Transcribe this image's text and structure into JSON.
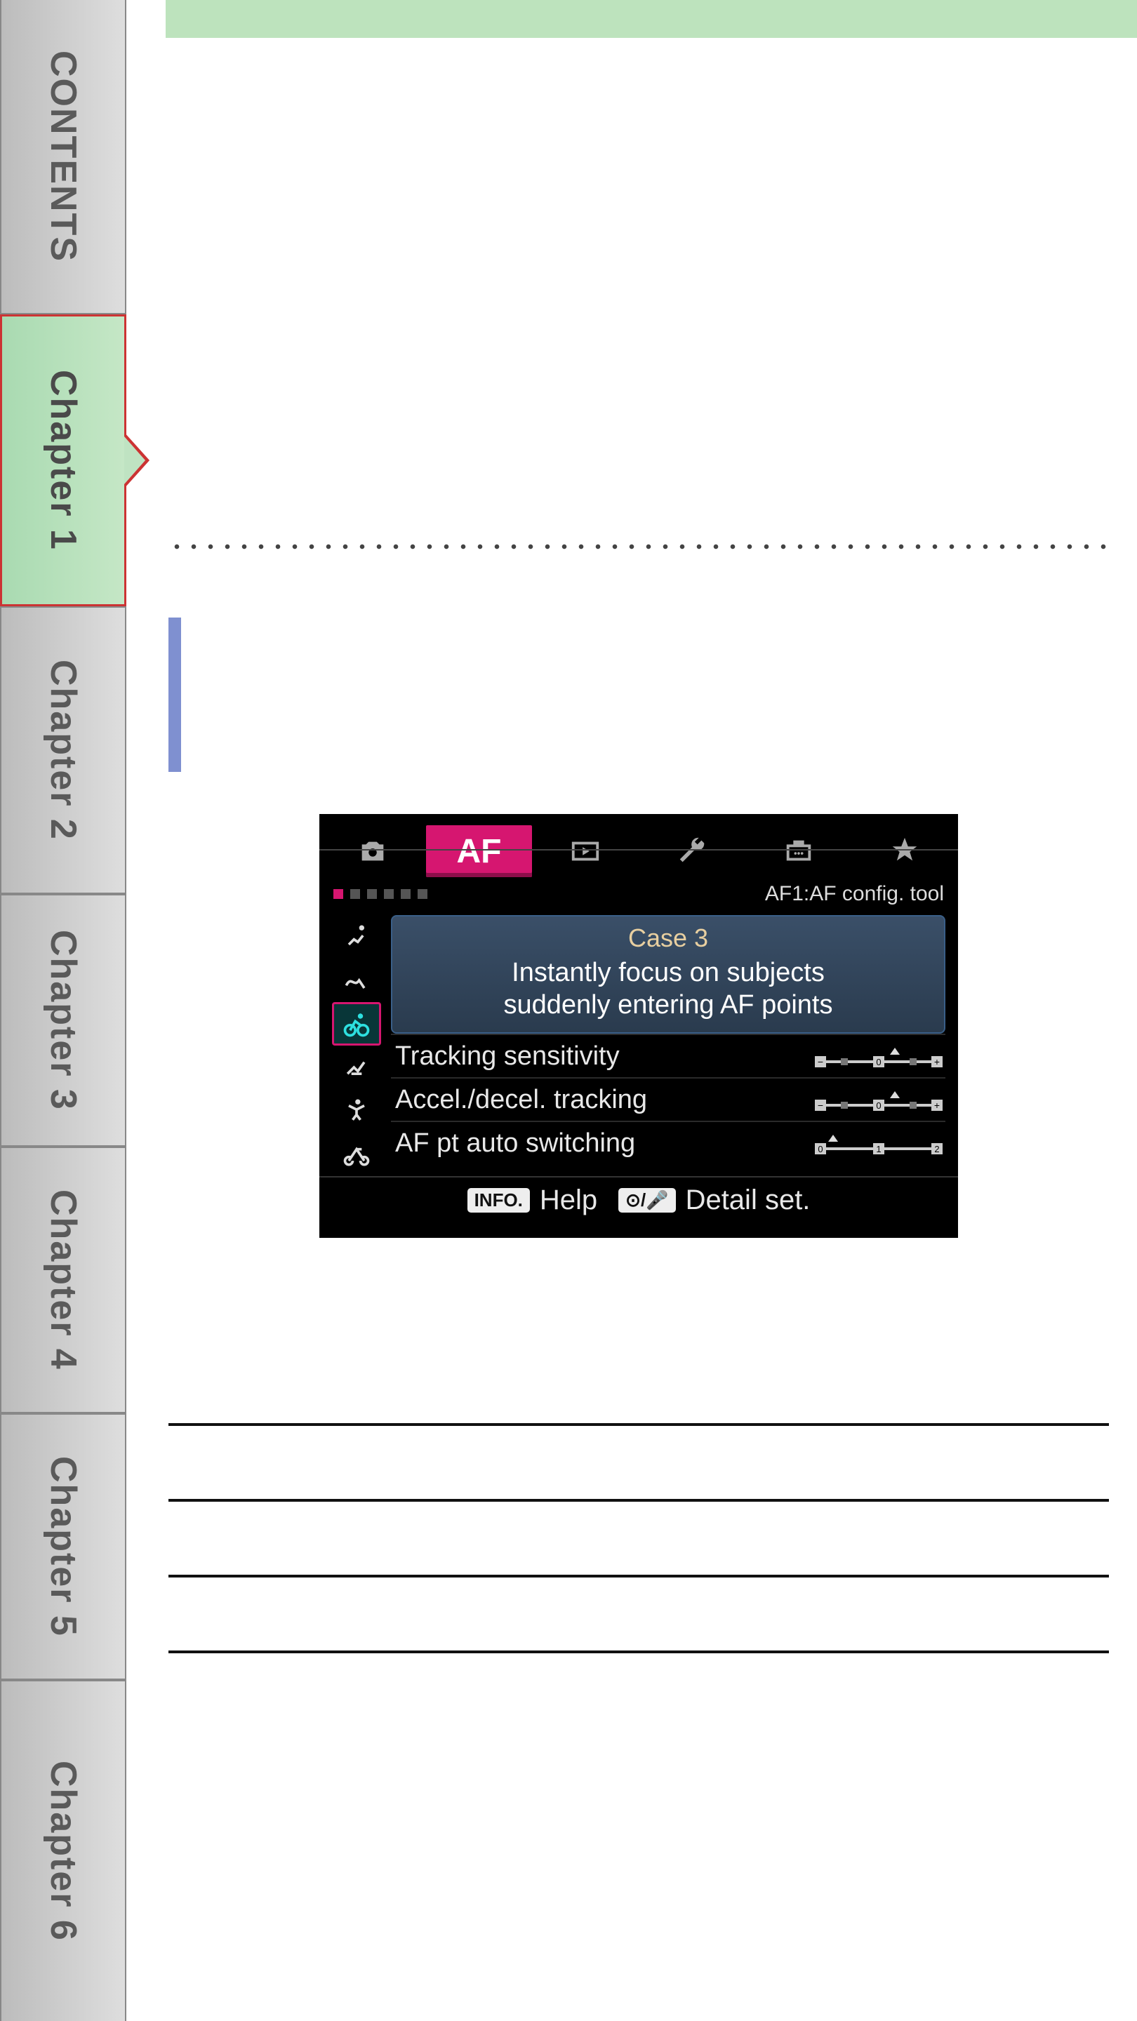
{
  "sidebar": {
    "items": [
      {
        "label": "CONTENTS"
      },
      {
        "label": "Chapter 1",
        "active": true
      },
      {
        "label": "Chapter 2"
      },
      {
        "label": "Chapter 3"
      },
      {
        "label": "Chapter 4"
      },
      {
        "label": "Chapter 5"
      },
      {
        "label": "Chapter 6"
      }
    ]
  },
  "camera_screenshot": {
    "top_tabs": [
      "camera",
      "AF",
      "playback",
      "wrench",
      "cfn",
      "star"
    ],
    "active_tab": "AF",
    "pager_dots": 6,
    "pager_active_index": 0,
    "subtitle": "AF1:AF config. tool",
    "side_icons": [
      "runner",
      "scribble",
      "cyclist",
      "hurdler",
      "dancer",
      "cyclist-side"
    ],
    "side_selected_index": 2,
    "case": {
      "title": "Case 3",
      "description_line1": "Instantly focus on subjects",
      "description_line2": "suddenly entering AF points"
    },
    "params": [
      {
        "label": "Tracking sensitivity",
        "scale": "minus-zero-plus"
      },
      {
        "label": "Accel./decel. tracking",
        "scale": "minus-zero-plus"
      },
      {
        "label": "AF pt auto switching",
        "scale": "zero-one-two"
      }
    ],
    "footer": {
      "left_badge": "INFO.",
      "left_label": "Help",
      "right_badge": "⊙/🎤",
      "right_label": "Detail set."
    }
  },
  "param_table_rows": 4
}
